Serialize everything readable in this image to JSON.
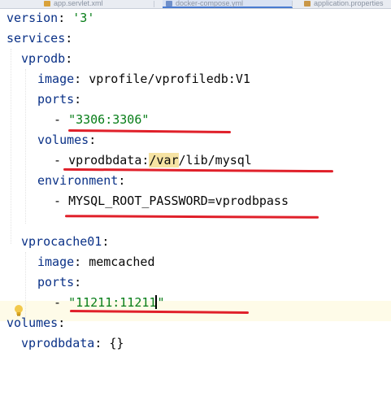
{
  "tabs": [
    {
      "label": "app.servlet.xml"
    },
    {
      "label": "docker-compose.yml"
    },
    {
      "label": "application.properties"
    }
  ],
  "code": {
    "version_key": "version",
    "version_value": "'3'",
    "services_key": "services",
    "db": {
      "name": "vprodb",
      "image_key": "image",
      "image_value": "vprofile/vprofiledb:V1",
      "ports_key": "ports",
      "port_value": "\"3306:3306\"",
      "volumes_key": "volumes",
      "volume_name": "vprodbdata",
      "volume_path_highlight": "/var",
      "volume_path_rest": "/lib/mysql",
      "environment_key": "environment",
      "env_value": "MYSQL_ROOT_PASSWORD=vprodbpass"
    },
    "cache": {
      "name": "vprocache01",
      "image_key": "image",
      "image_value": "memcached",
      "ports_key": "ports",
      "port_value_before_caret": "\"11211:11211",
      "port_value_after_caret": "\""
    },
    "volumes_key": "volumes",
    "vol_name": "vprodbdata",
    "vol_value": "{}"
  },
  "colors": {
    "key": "#0a3187",
    "string": "#067d17",
    "annotation_underline": "#e0202a",
    "current_line": "#fefbe8"
  },
  "icons": {
    "intention_bulb": "lightbulb-icon"
  }
}
